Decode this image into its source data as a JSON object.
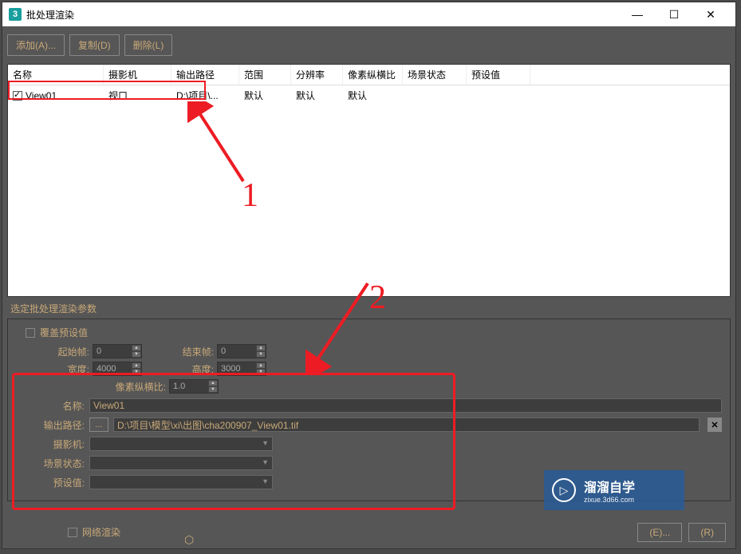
{
  "window": {
    "title": "批处理渲染",
    "icon": "3"
  },
  "winControls": {
    "min": "—",
    "max": "☐",
    "close": "✕"
  },
  "toolbar": {
    "add": "添加(A)...",
    "copy": "复制(D)",
    "delete": "删除(L)"
  },
  "table": {
    "headers": [
      "名称",
      "摄影机",
      "输出路径",
      "范围",
      "分辨率",
      "像素纵横比",
      "场景状态",
      "预设值"
    ],
    "row": {
      "name": "View01",
      "camera": "视口",
      "output": "D:\\项目\\...",
      "range": "默认",
      "res": "默认",
      "pixel": "默认"
    }
  },
  "section": {
    "title": "选定批处理渲染参数",
    "overridePreset": "覆盖预设值",
    "startFrame": {
      "label": "起始帧:",
      "value": "0"
    },
    "endFrame": {
      "label": "结束帧:",
      "value": "0"
    },
    "width": {
      "label": "宽度:",
      "value": "4000"
    },
    "height": {
      "label": "高度:",
      "value": "3000"
    },
    "pixelRatio": {
      "label": "像素纵横比:",
      "value": "1.0"
    },
    "name": {
      "label": "名称:",
      "value": "View01"
    },
    "outputPath": {
      "label": "输出路径:",
      "btn": "...",
      "value": "D:\\项目\\模型\\xi\\出图\\cha200907_View01.tif"
    },
    "camera": "摄影机:",
    "sceneState": "场景状态:",
    "preset": "预设值:",
    "netRender": "网络渲染"
  },
  "bottom": {
    "export": "(E)...",
    "render": "(R)"
  },
  "watermark": {
    "big": "溜溜自学",
    "small": "zixue.3d66.com"
  },
  "anno": {
    "n1": "1",
    "n2": "2"
  }
}
